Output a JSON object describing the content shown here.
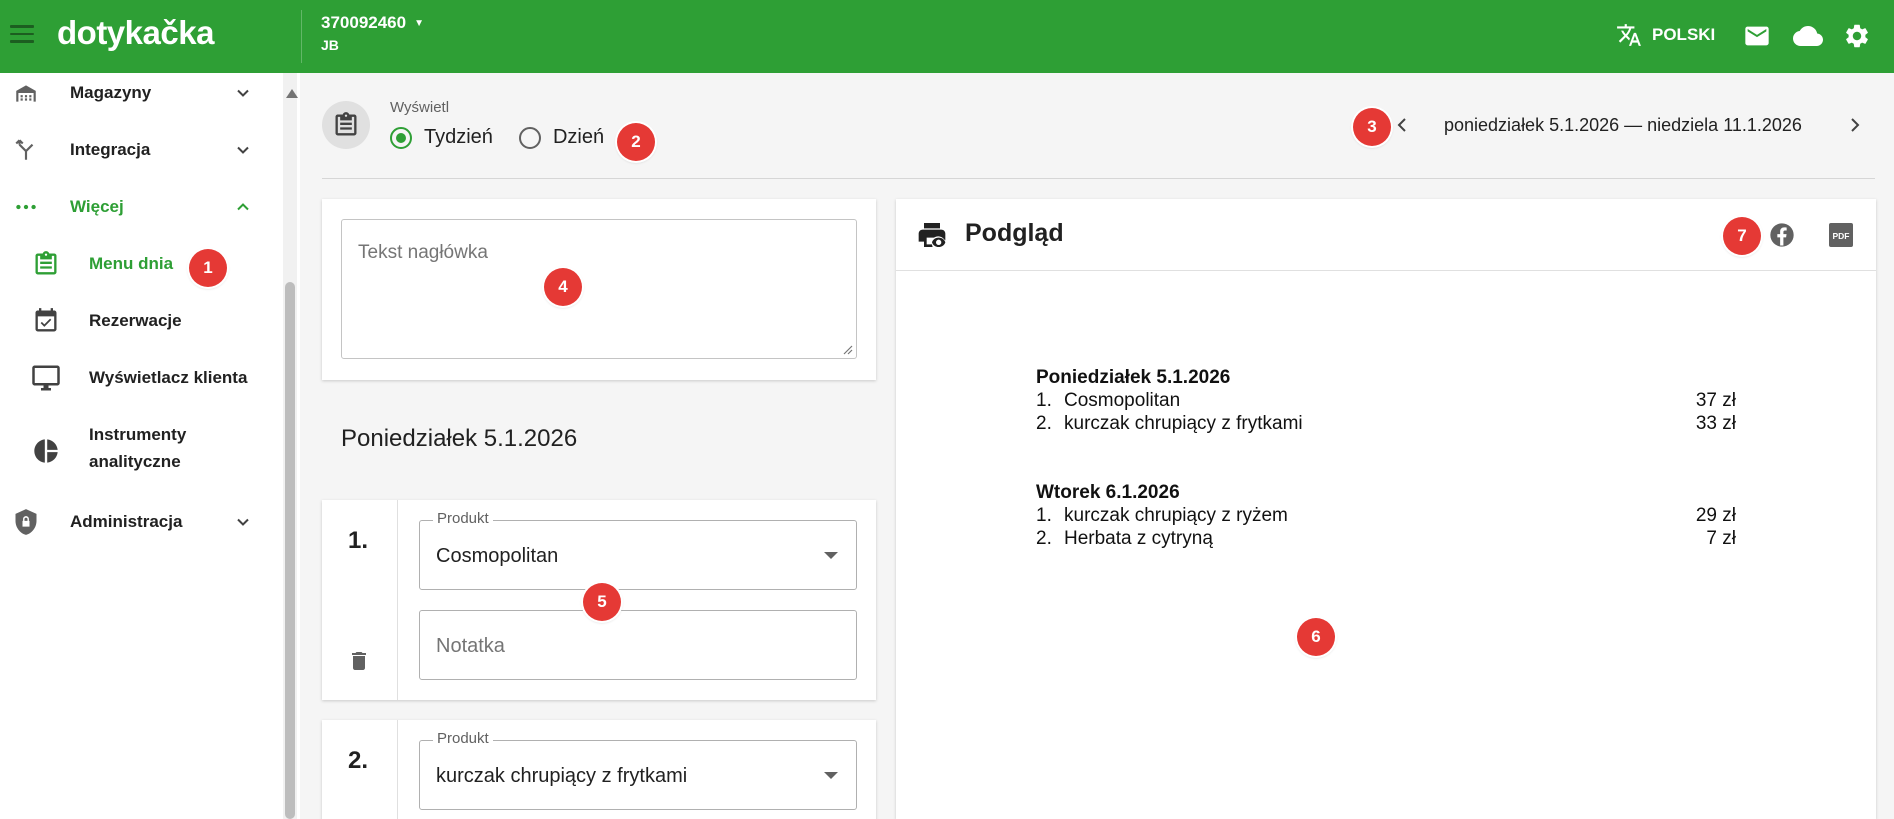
{
  "app": {
    "logo": "dotykačka",
    "account_number": "370092460",
    "account_user": "JB",
    "language": "POLSKI"
  },
  "sidebar": {
    "items": [
      {
        "label": "Magazyny",
        "icon": "warehouse-icon"
      },
      {
        "label": "Integracja",
        "icon": "merge-icon"
      },
      {
        "label": "Więcej",
        "icon": "more-horiz-icon"
      },
      {
        "label": "Menu dnia",
        "icon": "menu-clipboard-icon"
      },
      {
        "label": "Rezerwacje",
        "icon": "calendar-check-icon"
      },
      {
        "label": "Wyświetlacz klienta",
        "icon": "monitor-icon"
      },
      {
        "label": "Instrumenty analityczne",
        "icon": "pie-chart-icon"
      },
      {
        "label": "Administracja",
        "icon": "shield-lock-icon"
      }
    ]
  },
  "display": {
    "label": "Wyświetl",
    "options": [
      "Tydzień",
      "Dzień"
    ],
    "selected": "Tydzień",
    "date_range": "poniedziałek 5.1.2026 — niedziela 11.1.2026"
  },
  "editor": {
    "header_placeholder": "Tekst nagłówka",
    "day_title": "Poniedziałek 5.1.2026",
    "items": [
      {
        "number": "1.",
        "product_label": "Produkt",
        "product": "Cosmopolitan",
        "note_placeholder": "Notatka"
      },
      {
        "number": "2.",
        "product_label": "Produkt",
        "product": "kurczak chrupiący z frytkami"
      }
    ]
  },
  "preview": {
    "title": "Podgląd",
    "pdf_label": "PDF",
    "days": [
      {
        "title": "Poniedziałek 5.1.2026",
        "items": [
          {
            "n": "1.",
            "name": "Cosmopolitan",
            "price": "37 zł"
          },
          {
            "n": "2.",
            "name": "kurczak chrupiący z frytkami",
            "price": "33 zł"
          }
        ]
      },
      {
        "title": "Wtorek 6.1.2026",
        "items": [
          {
            "n": "1.",
            "name": "kurczak chrupiący z ryżem",
            "price": "29 zł"
          },
          {
            "n": "2.",
            "name": "Herbata z cytryną",
            "price": "7 zł"
          }
        ]
      }
    ]
  },
  "badges": [
    "1",
    "2",
    "3",
    "4",
    "5",
    "6",
    "7"
  ],
  "colors": {
    "brand": "#2e9f35",
    "badge": "#e53935"
  }
}
